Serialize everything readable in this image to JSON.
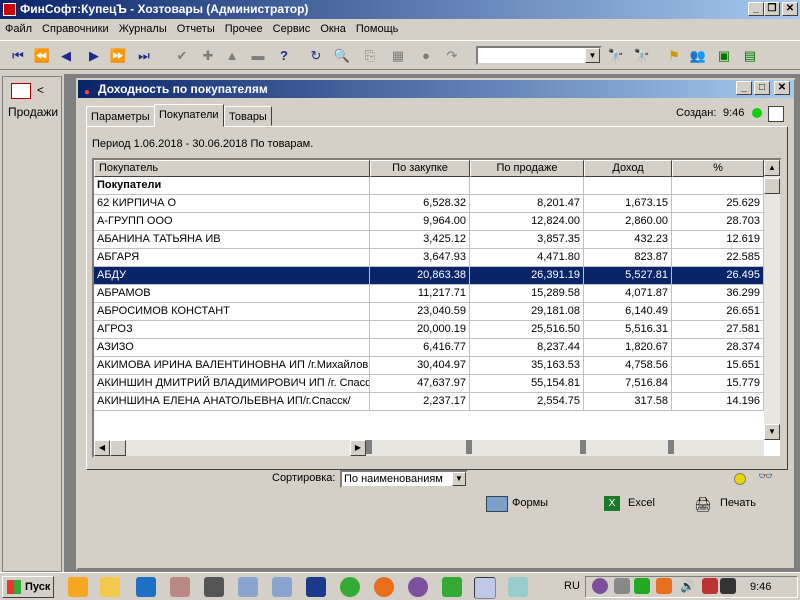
{
  "app": {
    "title": "ФинСофт:КупецЪ - Хозтовары  (Администратор)"
  },
  "menu": [
    "Файл",
    "Справочники",
    "Журналы",
    "Отчеты",
    "Прочее",
    "Сервис",
    "Окна",
    "Помощь"
  ],
  "toolbar": {
    "search_value": ""
  },
  "left_panel": {
    "label": "Продажи",
    "collapse": "<"
  },
  "report": {
    "title": "Доходность по покупателям",
    "tabs": [
      "Параметры",
      "Покупатели",
      "Товары"
    ],
    "active_tab": "Покупатели",
    "created_label": "Создан:",
    "created_time": "9:46",
    "period": "Период  1.06.2018 - 30.06.2018 По товарам.",
    "columns": [
      "Покупатель",
      "По закупке",
      "По продаже",
      "Доход",
      "%"
    ],
    "group_row": "Покупатели",
    "rows": [
      [
        "62 КИРПИЧА О",
        "6,528.32",
        "8,201.47",
        "1,673.15",
        "25.629"
      ],
      [
        "А-ГРУПП ООО",
        "9,964.00",
        "12,824.00",
        "2,860.00",
        "28.703"
      ],
      [
        "АБАНИНА ТАТЬЯНА ИВ",
        "3,425.12",
        "3,857.35",
        "432.23",
        "12.619"
      ],
      [
        "АБГАРЯ",
        "3,647.93",
        "4,471.80",
        "823.87",
        "22.585"
      ],
      [
        "АБДУ",
        "20,863.38",
        "26,391.19",
        "5,527.81",
        "26.495"
      ],
      [
        "АБРАМОВ",
        "11,217.71",
        "15,289.58",
        "4,071.87",
        "36.299"
      ],
      [
        "АБРОСИМОВ КОНСТАНТ",
        "23,040.59",
        "29,181.08",
        "6,140.49",
        "26.651"
      ],
      [
        "АГРОЗ",
        "20,000.19",
        "25,516.50",
        "5,516.31",
        "27.581"
      ],
      [
        "АЗИЗО",
        "6,416.77",
        "8,237.44",
        "1,820.67",
        "28.374"
      ],
      [
        "АКИМОВА ИРИНА ВАЛЕНТИНОВНА ИП /г.Михайлов",
        "30,404.97",
        "35,163.53",
        "4,758.56",
        "15.651"
      ],
      [
        "АКИНШИН ДМИТРИЙ ВЛАДИМИРОВИЧ ИП /г. Спасс",
        "47,637.97",
        "55,154.81",
        "7,516.84",
        "15.779"
      ],
      [
        "АКИНШИНА ЕЛЕНА АНАТОЛЬЕВНА ИП/г.Спасск/",
        "2,237.17",
        "2,554.75",
        "317.58",
        "14.196"
      ]
    ],
    "selected_row": 4,
    "sort_label": "Сортировка:",
    "sort_value": "По наименованиям",
    "buttons": {
      "forms": "Формы",
      "excel": "Excel",
      "print": "Печать"
    }
  },
  "taskbar": {
    "start": "Пуск",
    "lang": "RU",
    "clock": "9:46"
  }
}
